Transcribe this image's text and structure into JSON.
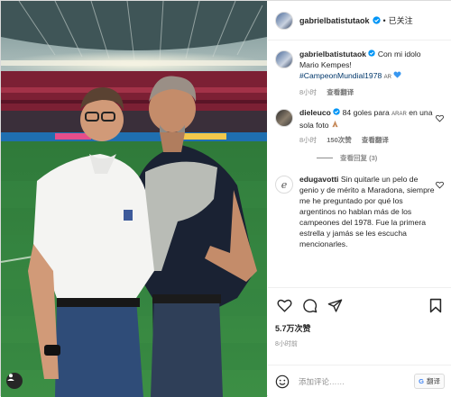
{
  "post": {
    "username": "gabrielbatistutaok",
    "follow_label": "已关注",
    "caption": {
      "username": "gabrielbatistutaok",
      "text": "Con mi idolo Mario Kempes!",
      "hashtag": "#CampeonMundial1978",
      "flag_text": "AR",
      "time": "8小时",
      "translate": "查看翻译"
    },
    "comments": [
      {
        "username": "dieleuco",
        "text": "84 goles para",
        "flag_text": "ARAR",
        "text2": "en una sola foto",
        "time": "8小时",
        "likes": "150次赞",
        "translate": "查看翻译",
        "replies": "查看回复 (3)"
      },
      {
        "username": "edugavotti",
        "avatar_letter": "e",
        "text": "Sin quitarle un pelo de genio y de mérito a Maradona, siempre me he preguntado por qué los argentinos no hablan más de los campeones del 1978. Fue la primera estrella y jamás se les escucha mencionarles."
      }
    ],
    "likes": "5.7万次赞",
    "date": "8小时前",
    "comment_placeholder": "添加评论……",
    "translate_button": "翻译",
    "colors": {
      "verified": "#0095f6",
      "hashtag": "#00376b",
      "heart_blue": "#3897f0"
    }
  }
}
